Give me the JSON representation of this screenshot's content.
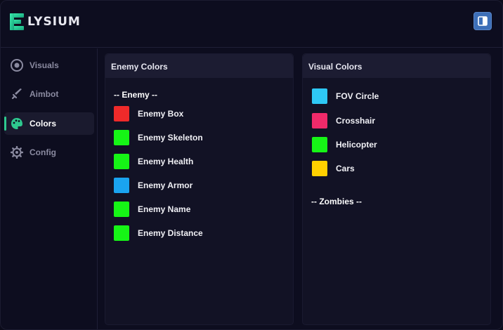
{
  "app": {
    "brand_letter": "E",
    "brand_rest": "LYSIUM",
    "accent": "#2ec88f"
  },
  "header": {
    "action_icon": "sidebar-toggle-icon"
  },
  "sidebar": {
    "items": [
      {
        "label": "Visuals",
        "icon": "eye-icon",
        "active": false
      },
      {
        "label": "Aimbot",
        "icon": "sword-icon",
        "active": false
      },
      {
        "label": "Colors",
        "icon": "palette-icon",
        "active": true
      },
      {
        "label": "Config",
        "icon": "gear-icon",
        "active": false
      }
    ]
  },
  "enemy_panel": {
    "title": "Enemy Colors",
    "section": "-- Enemy --",
    "rows": [
      {
        "label": "Enemy Box",
        "color": "#ef2a2a"
      },
      {
        "label": "Enemy Skeleton",
        "color": "#16f516"
      },
      {
        "label": "Enemy Health",
        "color": "#16f516"
      },
      {
        "label": "Enemy Armor",
        "color": "#1aa4f0"
      },
      {
        "label": "Enemy Name",
        "color": "#16f516"
      },
      {
        "label": "Enemy Distance",
        "color": "#16f516"
      }
    ]
  },
  "visual_panel": {
    "title": "Visual Colors",
    "rows": [
      {
        "label": "FOV Circle",
        "color": "#2ec8f5"
      },
      {
        "label": "Crosshair",
        "color": "#f02a6a"
      },
      {
        "label": "Helicopter",
        "color": "#16f516"
      },
      {
        "label": "Cars",
        "color": "#ffd000"
      }
    ],
    "section_2": "-- Zombies --"
  }
}
